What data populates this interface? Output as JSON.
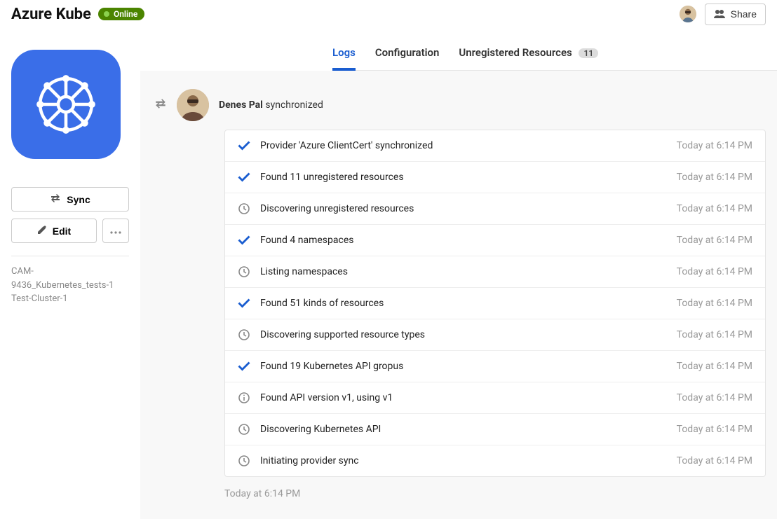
{
  "header": {
    "title": "Azure Kube",
    "status_label": "Online",
    "share_label": "Share"
  },
  "tabs": {
    "logs": "Logs",
    "configuration": "Configuration",
    "unregistered": "Unregistered Resources",
    "unregistered_count": "11"
  },
  "sidebar": {
    "sync_label": "Sync",
    "edit_label": "Edit",
    "meta_line1": "CAM-9436_Kubernetes_tests-1",
    "meta_line2": "Test-Cluster-1"
  },
  "event": {
    "actor": "Denes Pal",
    "action": " synchronized"
  },
  "logs": [
    {
      "icon": "check",
      "msg": "Provider 'Azure ClientCert' synchronized",
      "time": "Today at 6:14 PM"
    },
    {
      "icon": "check",
      "msg": "Found 11 unregistered resources",
      "time": "Today at 6:14 PM"
    },
    {
      "icon": "clock",
      "msg": "Discovering unregistered resources",
      "time": "Today at 6:14 PM"
    },
    {
      "icon": "check",
      "msg": "Found 4 namespaces",
      "time": "Today at 6:14 PM"
    },
    {
      "icon": "clock",
      "msg": "Listing namespaces",
      "time": "Today at 6:14 PM"
    },
    {
      "icon": "check",
      "msg": "Found 51 kinds of resources",
      "time": "Today at 6:14 PM"
    },
    {
      "icon": "clock",
      "msg": "Discovering supported resource types",
      "time": "Today at 6:14 PM"
    },
    {
      "icon": "check",
      "msg": "Found 19 Kubernetes API gropus",
      "time": "Today at 6:14 PM"
    },
    {
      "icon": "info",
      "msg": "Found API version v1, using v1",
      "time": "Today at 6:14 PM"
    },
    {
      "icon": "clock",
      "msg": "Discovering Kubernetes API",
      "time": "Today at 6:14 PM"
    },
    {
      "icon": "clock",
      "msg": "Initiating provider sync",
      "time": "Today at 6:14 PM"
    }
  ],
  "footer_time": "Today at 6:14 PM"
}
